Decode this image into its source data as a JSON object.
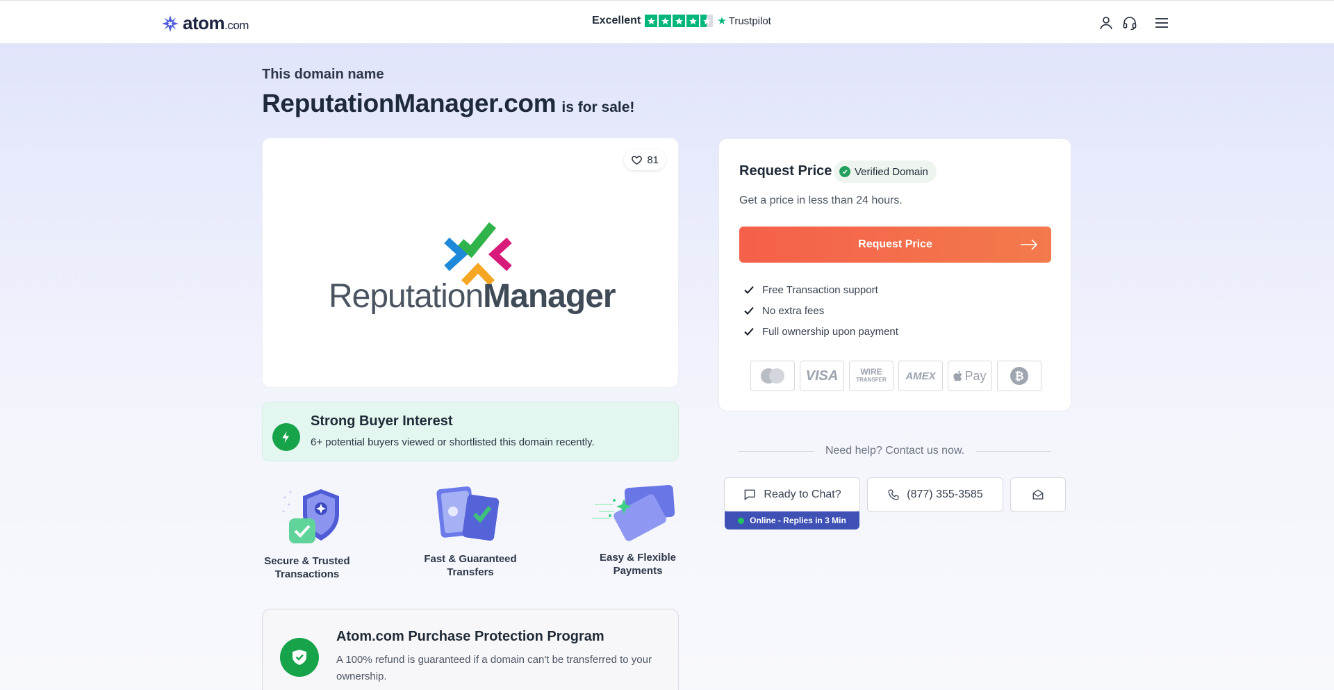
{
  "header": {
    "logo_text": "atom",
    "logo_suffix": ".com",
    "trustpilot_rating": "Excellent",
    "trustpilot_stars": 4.5,
    "trustpilot_brand": "Trustpilot",
    "icons": [
      "user-icon",
      "headset-icon",
      "menu-icon"
    ]
  },
  "hero": {
    "eyebrow": "This domain name",
    "domain": "ReputationManager.com",
    "suffix": "is for sale!"
  },
  "logo_card": {
    "likes": "81",
    "brand_light": "Reputation",
    "brand_bold": "Manager"
  },
  "interest": {
    "title": "Strong Buyer Interest",
    "subtitle": "6+ potential buyers viewed or shortlisted this domain recently."
  },
  "features": [
    {
      "label_line1": "Secure & Trusted",
      "label_line2": "Transactions"
    },
    {
      "label_line1": "Fast & Guaranteed",
      "label_line2": "Transfers"
    },
    {
      "label_line1": "Easy & Flexible",
      "label_line2": "Payments"
    }
  ],
  "protection": {
    "title": "Atom.com Purchase Protection Program",
    "subtitle": "A 100% refund is guaranteed if a domain can't be transferred to your ownership."
  },
  "price_card": {
    "title": "Request Price",
    "verified_label": "Verified Domain",
    "subtitle": "Get a price in less than 24 hours.",
    "button_label": "Request Price",
    "perks": [
      "Free Transaction support",
      "No extra fees",
      "Full ownership upon payment"
    ],
    "payment_methods": [
      "mastercard-icon",
      "visa-icon",
      "wire-transfer-icon",
      "amex-icon",
      "apple-pay-icon",
      "bitcoin-icon"
    ],
    "visa_text": "VISA",
    "amex_text": "AMEX",
    "wire_line1": "WIRE",
    "wire_line2": "TRANSFER",
    "applepay_text": "Pay"
  },
  "contact": {
    "help_text": "Need help? Contact us now.",
    "chat_label": "Ready to Chat?",
    "online_status": "Online - Replies in 3 Min",
    "phone": "(877) 355-3585"
  },
  "colors": {
    "accent_orange": "#f4604a",
    "green": "#16a34a",
    "trustpilot_green": "#00b67a",
    "online_bar": "#3f51b5"
  }
}
